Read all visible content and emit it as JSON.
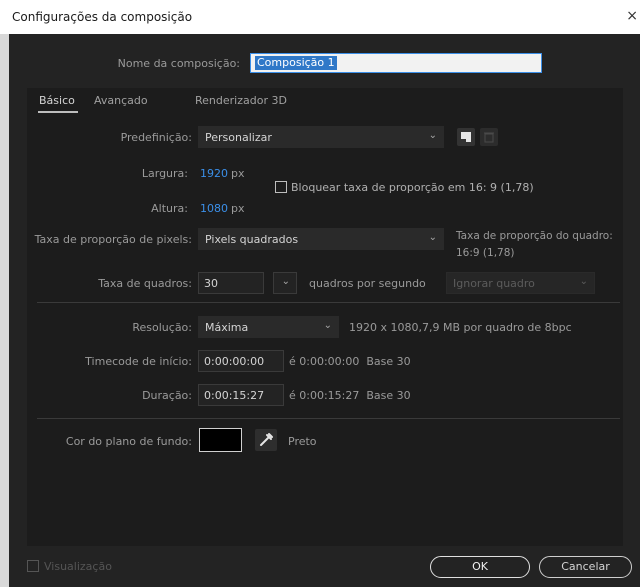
{
  "window": {
    "title": "Configurações da composição",
    "close_glyph": "×"
  },
  "name": {
    "label": "Nome da composição:",
    "value": "Composição 1"
  },
  "tabs": [
    {
      "label": "Básico",
      "active": true
    },
    {
      "label": "Avançado",
      "active": false
    },
    {
      "label": "Renderizador 3D",
      "active": false
    }
  ],
  "preset": {
    "label": "Predefinição:",
    "value": "Personalizar"
  },
  "width": {
    "label": "Largura:",
    "value": "1920",
    "unit": "px"
  },
  "height": {
    "label": "Altura:",
    "value": "1080",
    "unit": "px"
  },
  "lock_ratio": {
    "label": "Bloquear taxa de proporção em 16: 9 (1,78)",
    "checked": false
  },
  "pixel_aspect": {
    "label": "Taxa de proporção de pixels:",
    "value": "Pixels quadrados"
  },
  "frame_aspect": {
    "label": "Taxa de proporção do quadro:",
    "value": "16:9 (1,78)"
  },
  "frame_rate": {
    "label": "Taxa de quadros:",
    "value": "30",
    "unit": "quadros por segundo",
    "drop_frame": "Ignorar quadro"
  },
  "resolution": {
    "label": "Resolução:",
    "value": "Máxima",
    "info": "1920 x 1080,7,9 MB por quadro de 8bpc"
  },
  "start_timecode": {
    "label": "Timecode de início:",
    "value": "0:00:00:00",
    "info": "é 0:00:00:00  Base 30"
  },
  "duration": {
    "label": "Duração:",
    "value": "0:00:15:27",
    "info": "é 0:00:15:27  Base 30"
  },
  "background": {
    "label": "Cor do plano de fundo:",
    "color": "#000000",
    "name": "Preto"
  },
  "footer": {
    "preview_label": "Visualização",
    "ok_label": "OK",
    "cancel_label": "Cancelar"
  },
  "colors": {
    "accent": "#3b8fe8",
    "panel": "#1c1c1c",
    "dialog": "#232323"
  },
  "icons": {
    "dropdown": "chevron-down-icon",
    "new_preset": "save-preset-icon",
    "delete_preset": "trash-icon",
    "eyedropper": "eyedropper-icon"
  }
}
